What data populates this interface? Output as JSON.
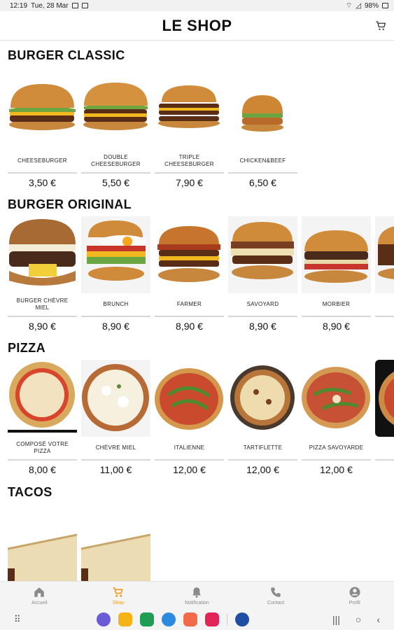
{
  "status": {
    "time": "12:19",
    "date": "Tue, 28 Mar",
    "battery": "98%"
  },
  "appbar": {
    "title": "LE SHOP"
  },
  "sections": [
    {
      "title": "BURGER CLASSIC",
      "items": [
        {
          "name": "CHEESEBURGER",
          "price": "3,50 €"
        },
        {
          "name": "DOUBLE CHEESEBURGER",
          "price": "5,50 €"
        },
        {
          "name": "TRIPLE CHEESEBURGER",
          "price": "7,90 €"
        },
        {
          "name": "CHICKEN&BEEF",
          "price": "6,50 €"
        }
      ]
    },
    {
      "title": "BURGER ORIGINAL",
      "items": [
        {
          "name": "BURGER CHÈVRE MIEL",
          "price": "8,90 €"
        },
        {
          "name": "BRUNCH",
          "price": "8,90 €"
        },
        {
          "name": "FARMER",
          "price": "8,90 €"
        },
        {
          "name": "SAVOYARD",
          "price": "8,90 €"
        },
        {
          "name": "MORBIER",
          "price": "8,90 €"
        },
        {
          "name": "",
          "price": ""
        }
      ]
    },
    {
      "title": "PIZZA",
      "items": [
        {
          "name": "COMPOSÉ VOTRE PIZZA",
          "price": "8,00 €"
        },
        {
          "name": "CHÈVRE MIEL",
          "price": "11,00 €"
        },
        {
          "name": "ITALIENNE",
          "price": "12,00 €"
        },
        {
          "name": "TARTIFLETTE",
          "price": "12,00 €"
        },
        {
          "name": "PIZZA SAVOYARDE",
          "price": "12,00 €"
        },
        {
          "name": "",
          "price": ""
        }
      ]
    },
    {
      "title": "TACOS",
      "items": [
        {
          "name": "",
          "price": ""
        },
        {
          "name": "",
          "price": ""
        }
      ]
    }
  ],
  "nav": [
    {
      "label": "Accueil",
      "icon": "home-icon"
    },
    {
      "label": "Shop",
      "icon": "cart-icon"
    },
    {
      "label": "Notification",
      "icon": "bell-icon"
    },
    {
      "label": "Contact",
      "icon": "phone-icon"
    },
    {
      "label": "Profil",
      "icon": "user-icon"
    }
  ],
  "colors": {
    "accent": "#f39b1c",
    "inactive": "#8a8a8a"
  }
}
